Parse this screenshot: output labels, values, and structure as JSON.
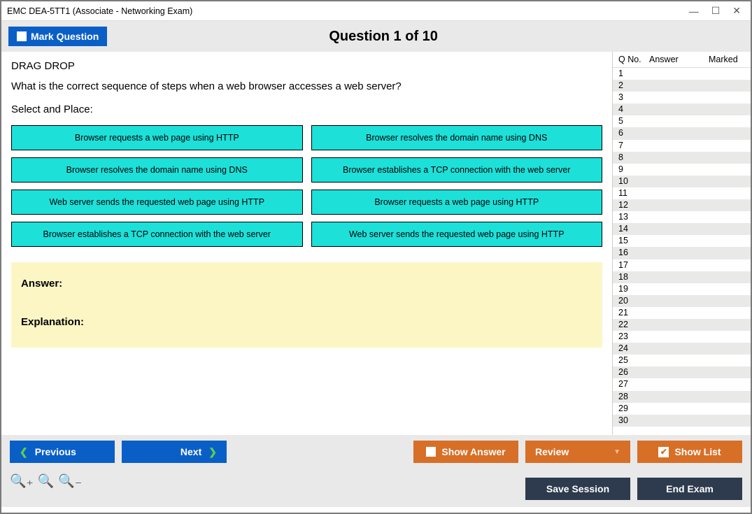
{
  "window": {
    "title": "EMC DEA-5TT1 (Associate - Networking Exam)"
  },
  "header": {
    "mark_label": "Mark Question",
    "question_title": "Question 1 of 10"
  },
  "question": {
    "type": "DRAG DROP",
    "text": "What is the correct sequence of steps when a web browser accesses a web server?",
    "select_place": "Select and Place:"
  },
  "drag": {
    "left": [
      "Browser requests a web page using HTTP",
      "Browser resolves the domain name using DNS",
      "Web server sends the requested web page using HTTP",
      "Browser establishes a TCP connection with the web server"
    ],
    "right": [
      "Browser resolves the domain name using DNS",
      "Browser establishes a TCP connection with the web server",
      "Browser requests a web page using HTTP",
      "Web server sends the requested web page using HTTP"
    ]
  },
  "answer_box": {
    "answer_label": "Answer:",
    "explanation_label": "Explanation:"
  },
  "side": {
    "headers": {
      "qno": "Q No.",
      "answer": "Answer",
      "marked": "Marked"
    },
    "rows": [
      "1",
      "2",
      "3",
      "4",
      "5",
      "6",
      "7",
      "8",
      "9",
      "10",
      "11",
      "12",
      "13",
      "14",
      "15",
      "16",
      "17",
      "18",
      "19",
      "20",
      "21",
      "22",
      "23",
      "24",
      "25",
      "26",
      "27",
      "28",
      "29",
      "30"
    ]
  },
  "footer": {
    "previous": "Previous",
    "next": "Next",
    "show_answer": "Show Answer",
    "review": "Review",
    "show_list": "Show List",
    "save_session": "Save Session",
    "end_exam": "End Exam"
  }
}
